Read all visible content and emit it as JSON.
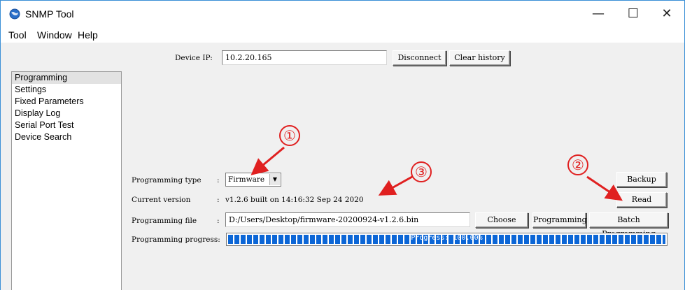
{
  "window": {
    "title": "SNMP Tool",
    "controls": {
      "minimize": "—",
      "maximize": "☐",
      "close": "✕"
    }
  },
  "menu": {
    "items": [
      "Tool",
      "Window",
      "Help"
    ]
  },
  "device": {
    "ip_label": "Device IP:",
    "ip_value": "10.2.20.165",
    "disconnect_label": "Disconnect",
    "clear_history_label": "Clear history"
  },
  "sidebar": {
    "items": [
      "Programming",
      "Settings",
      "Fixed Parameters",
      "Display Log",
      "Serial Port Test",
      "Device Search"
    ],
    "selected_index": 0
  },
  "programming": {
    "type_label": "Programming type",
    "type_value": "Firmware",
    "version_label": "Current version",
    "version_value": "v1.2.6 built on 14:16:32 Sep 24 2020",
    "file_label": "Programming file",
    "file_value": "D:/Users/Desktop/firmware-20200924-v1.2.6.bin",
    "progress_label": "Programming progress:",
    "progress_text": "Progress: 100.00%",
    "progress_fraction": 1.0,
    "colon": ":"
  },
  "buttons": {
    "backup": "Backup",
    "read": "Read",
    "choose": "Choose",
    "programming": "Programming",
    "batch_programming": "Batch Programming"
  },
  "annotations": [
    "①",
    "②",
    "③"
  ],
  "colors": {
    "annotation": "#e02020",
    "progress": "#0c66d6",
    "window_border": "#3a8fd6"
  }
}
